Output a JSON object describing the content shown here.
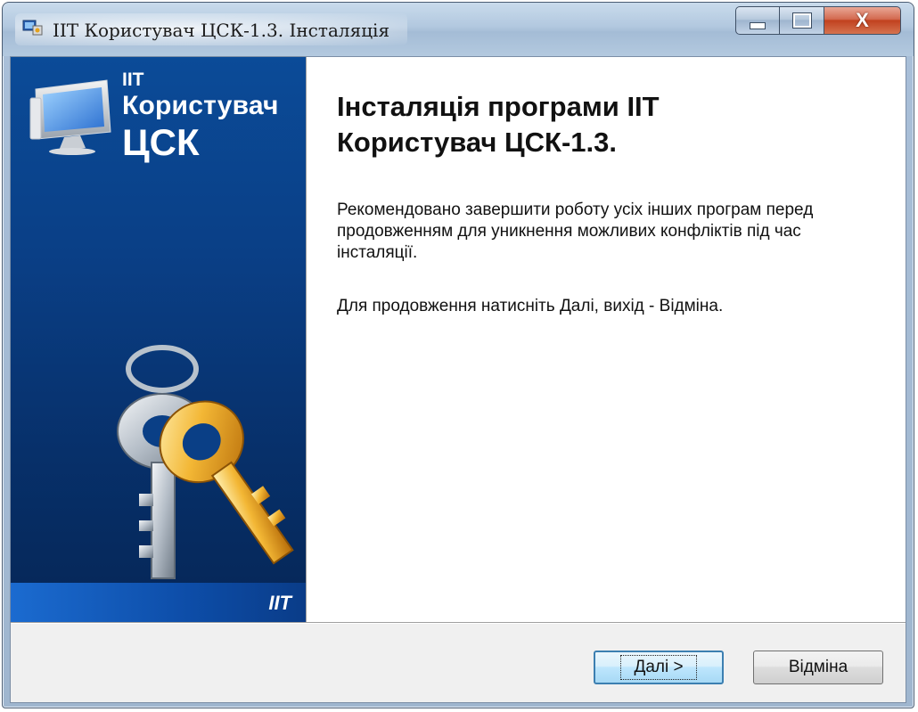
{
  "window": {
    "title": "ІІТ Користувач ЦСК-1.3. Інсталяція"
  },
  "caption_buttons": {
    "close_glyph": "X"
  },
  "sidebar": {
    "brand_small": "ІІТ",
    "brand_word": "Користувач",
    "brand_csk": "ЦСК",
    "brand_bottom": "IIT"
  },
  "main": {
    "heading_line1": "Інсталяція програми ІІТ",
    "heading_line2": "Користувач ЦСК-1.3.",
    "paragraph1": "Рекомендовано завершити роботу усіх інших програм перед продовженням для уникнення можливих конфліктів під час інсталяції.",
    "paragraph2": "Для продовження натисніть Далі, вихід - Відміна."
  },
  "buttons": {
    "next_mnemonic": "Д",
    "next_rest": "алі >",
    "cancel_label": "Відміна"
  },
  "colors": {
    "sidebar_blue": "#0a3f86",
    "close_red": "#c1411f",
    "focus_blue": "#3c7fb1"
  }
}
